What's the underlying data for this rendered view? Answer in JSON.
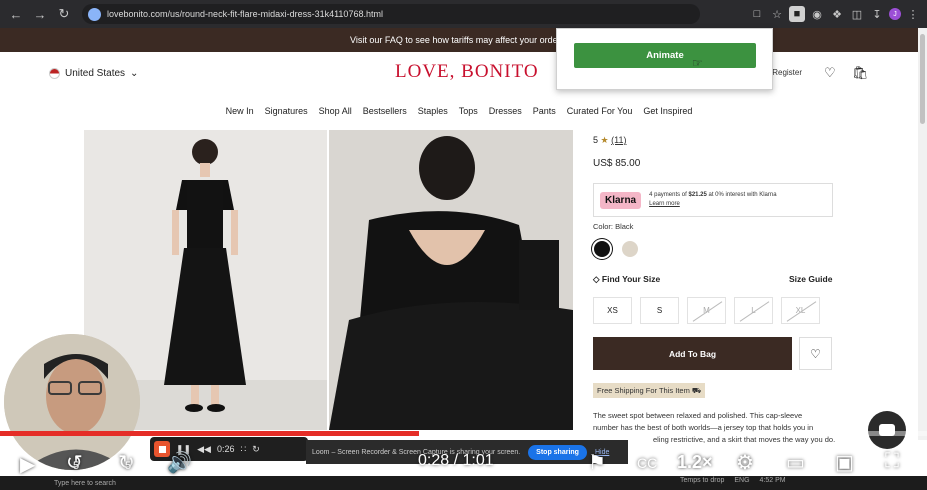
{
  "browser": {
    "url": "lovebonito.com/us/round-neck-fit-flare-midaxi-dress-31k4110768.html",
    "icons": [
      "back-icon",
      "forward-icon",
      "reload-icon",
      "cast-icon",
      "star-icon",
      "extension-icon",
      "puzzle-icon",
      "sidebar-icon",
      "download-icon",
      "menu-icon"
    ],
    "profile_initial": "J"
  },
  "extension_popup": {
    "button_label": "Animate",
    "button_color": "#3c9240"
  },
  "site": {
    "promo": "Visit our FAQ to see how tariffs may affect your orde",
    "country": "United States",
    "logo": "LOVE, BONITO",
    "login": "/Register",
    "brand_color": "#c8102e",
    "nav": [
      "New In",
      "Signatures",
      "Shop All",
      "Bestsellers",
      "Staples",
      "Tops",
      "Dresses",
      "Pants",
      "Curated For You",
      "Get Inspired"
    ]
  },
  "product": {
    "rating": "5",
    "reviews": "(11)",
    "price": "US$ 85.00",
    "klarna": {
      "badge": "Klarna",
      "text_a": "4 payments of ",
      "text_amount": "$21.25",
      "text_b": " at 0% interest with Klarna",
      "link": "Learn more"
    },
    "color_label": "Color:  Black",
    "find_size": "Find Your Size",
    "size_guide": "Size Guide",
    "sizes": [
      {
        "label": "XS",
        "available": true
      },
      {
        "label": "S",
        "available": true
      },
      {
        "label": "M",
        "available": false
      },
      {
        "label": "L",
        "available": false
      },
      {
        "label": "XL",
        "available": false
      }
    ],
    "add_to_bag": "Add To Bag",
    "shipping": "Free Shipping For This Item",
    "description": [
      "The sweet spot between relaxed and polished. This cap-sleeve",
      "number has the best of both worlds—a jersey top that holds you in",
      "eling restrictive, and a skirt that moves the way you do."
    ]
  },
  "loom": {
    "timer": "0:26",
    "share_text": "Loom – Screen Recorder & Screen Capture is sharing your screen.",
    "stop_label": "Stop sharing",
    "hide_label": "Hide"
  },
  "player": {
    "time": "0:28 / 1:01",
    "speed": "1.2×",
    "progress": 0.452,
    "skip_back": "5",
    "skip_fwd": "5"
  },
  "taskbar": {
    "search_placeholder": "Type here to search",
    "right_text": "Temps to drop",
    "lang": "ENG",
    "clock": "4:52 PM"
  }
}
